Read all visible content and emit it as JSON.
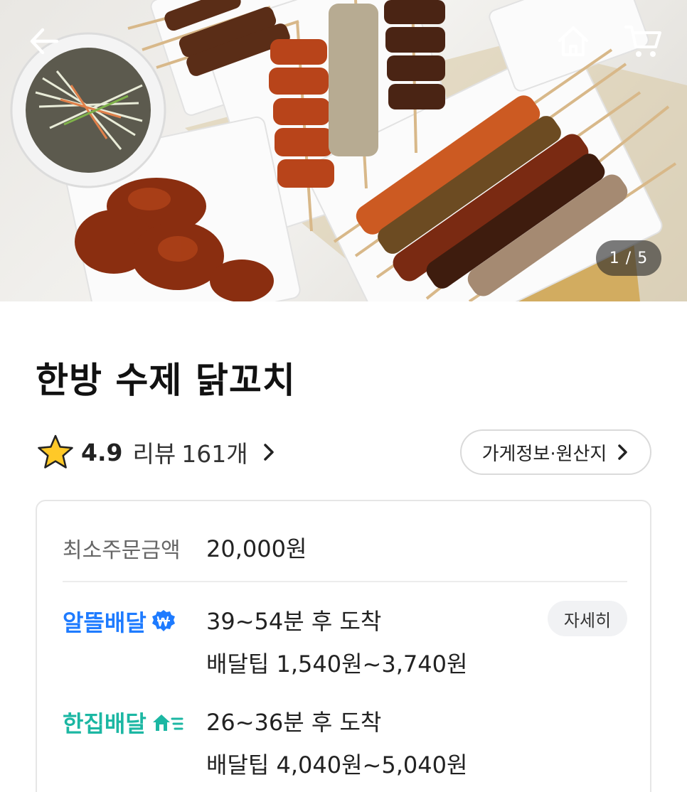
{
  "hero": {
    "image_alt": "Grilled chicken skewers platter",
    "counter": "1 / 5",
    "icons": {
      "back": "arrow-left-icon",
      "home": "home-icon",
      "cart": "cart-icon"
    }
  },
  "store": {
    "name": "한방 수제 닭꼬치",
    "rating": "4.9",
    "review_label": "리뷰",
    "review_count": "161개",
    "info_button": "가게정보·원산지"
  },
  "delivery": {
    "min_order_label": "최소주문금액",
    "min_order_value": "20,000원",
    "options": [
      {
        "brand": "알뜰배달",
        "brand_icon": "won-badge-icon",
        "eta": "39~54분 후 도착",
        "tip": "배달팁 1,540원~3,740원",
        "detail_button": "자세히"
      },
      {
        "brand": "한집배달",
        "brand_icon": "fast-home-icon",
        "eta": "26~36분 후 도착",
        "tip": "배달팁 4,040원~5,040원"
      }
    ]
  },
  "colors": {
    "allttle_blue": "#1e7bff",
    "hanjip_teal": "#1cb7a3",
    "star_yellow": "#ffc928"
  }
}
